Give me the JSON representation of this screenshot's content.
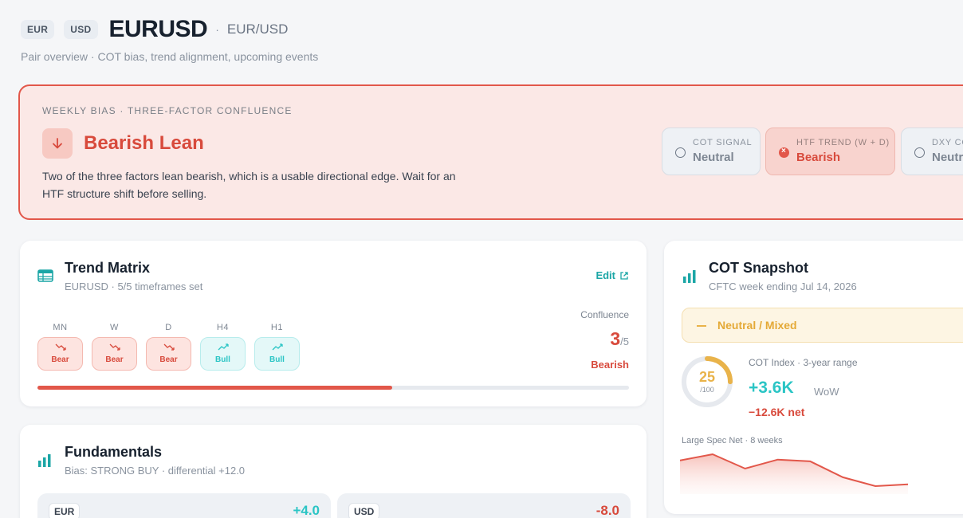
{
  "header": {
    "chip_base": "EUR",
    "chip_quote": "USD",
    "symbol": "EURUSD",
    "separator": "·",
    "pair_display": "EUR/USD",
    "subtitle": "Pair overview · COT bias, trend alignment, upcoming events"
  },
  "bias": {
    "kicker": "WEEKLY BIAS · THREE-FACTOR CONFLUENCE",
    "title": "Bearish Lean",
    "description": "Two of the three factors lean bearish, which is a usable directional edge. Wait for an HTF structure shift before selling.",
    "color": "#d84a3c",
    "factors": [
      {
        "label": "COT SIGNAL",
        "value": "Neutral",
        "state": "neutral"
      },
      {
        "label": "HTF TREND (W + D)",
        "value": "Bearish",
        "state": "bear"
      },
      {
        "label": "DXY CO",
        "value": "Neutr",
        "state": "neutral"
      }
    ]
  },
  "trend_matrix": {
    "title": "Trend Matrix",
    "subtitle": "EURUSD · 5/5 timeframes set",
    "edit_label": "Edit",
    "timeframes": [
      {
        "label": "MN",
        "state": "Bear"
      },
      {
        "label": "W",
        "state": "Bear"
      },
      {
        "label": "D",
        "state": "Bear"
      },
      {
        "label": "H4",
        "state": "Bull"
      },
      {
        "label": "H1",
        "state": "Bull"
      }
    ],
    "confluence_label": "Confluence",
    "confluence_value": "3",
    "confluence_total": "/5",
    "confluence_bias": "Bearish",
    "progress": 0.6
  },
  "fundamentals": {
    "title": "Fundamentals",
    "subtitle": "Bias: STRONG BUY · differential +12.0",
    "currencies": [
      {
        "code": "EUR",
        "score": "+4.0",
        "color": "#2bc5c5"
      },
      {
        "code": "USD",
        "score": "-8.0",
        "color": "#d84a3c"
      }
    ]
  },
  "cot": {
    "title": "COT Snapshot",
    "subtitle": "CFTC week ending Jul 14, 2026",
    "status": "Neutral / Mixed",
    "index_label": "COT Index · 3-year range",
    "index_value": "25",
    "index_max": "/100",
    "index_fraction": 0.25,
    "wow_value": "+3.6K",
    "wow_label": "WoW",
    "net_value": "−12.6K net",
    "spark_label": "Large Spec Net · 8 weeks",
    "spark_values": [
      -8.0,
      -4.5,
      -12.6,
      -7.5,
      -8.5,
      -17.5,
      -22.5,
      -21.5
    ]
  }
}
